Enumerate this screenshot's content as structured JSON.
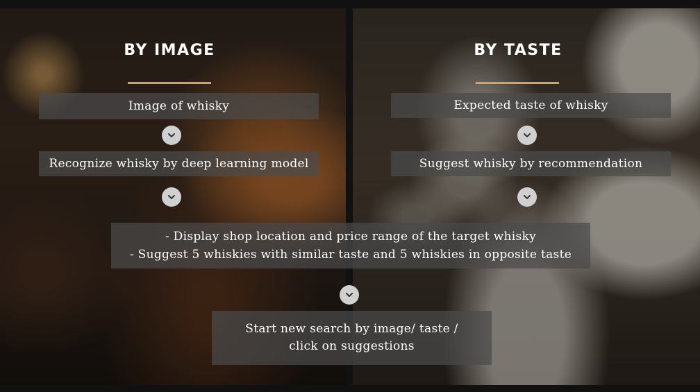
{
  "left_panel": {
    "heading": "BY IMAGE",
    "step1": "Image of whisky",
    "step2": "Recognize whisky by deep learning model"
  },
  "right_panel": {
    "heading": "BY TASTE",
    "step1": "Expected taste of whisky",
    "step2": "Suggest whisky by recommendation"
  },
  "result": {
    "line1": "- Display shop location and price range of the target whisky",
    "line2": "- Suggest 5 whiskies with similar taste and 5 whiskies in opposite taste"
  },
  "restart": {
    "line1": "Start new search by image/ taste /",
    "line2": "click on suggestions"
  },
  "icons": {
    "chevron": "chevron-down-icon"
  },
  "colors": {
    "accent_underline": "#c8a47a",
    "box_bg": "#4b4b4b",
    "chevron_bg": "#d0d0d0"
  }
}
